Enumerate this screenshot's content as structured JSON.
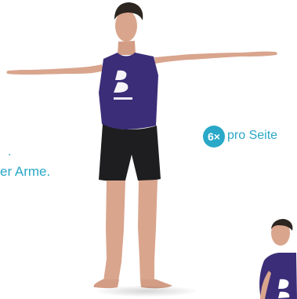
{
  "page": {
    "cropped_dot": ".",
    "instruction_fragment": "er Arme."
  },
  "repetition": {
    "count_label": "6×",
    "suffix_label": "pro Seite",
    "accent_color": "#29a8c8",
    "text_color": "#2aa7c7"
  },
  "illustration": {
    "main_figure": "man-standing-arms-out-icon",
    "secondary_figure": "man-partial-crop-icon",
    "shirt_color": "#3b2d78",
    "shorts_color": "#1e1e20",
    "skin_color": "#d9a58d"
  }
}
